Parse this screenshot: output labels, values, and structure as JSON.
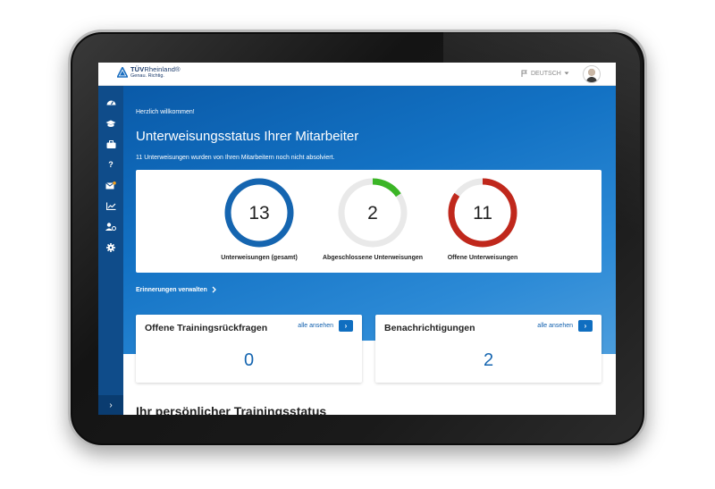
{
  "brand": {
    "name_bold": "TÜV",
    "name_rest": "Rheinland",
    "reg": "®",
    "tagline": "Genau. Richtig."
  },
  "header": {
    "language": "DEUTSCH"
  },
  "sidebar": {
    "items": [
      {
        "icon": "dashboard-icon"
      },
      {
        "icon": "graduation-cap-icon"
      },
      {
        "icon": "briefcase-icon"
      },
      {
        "icon": "help-icon",
        "glyph": "?"
      },
      {
        "icon": "mail-icon"
      },
      {
        "icon": "chart-icon"
      },
      {
        "icon": "user-settings-icon"
      },
      {
        "icon": "gear-icon"
      }
    ],
    "expand_glyph": "›"
  },
  "hero": {
    "greeting": "Herzlich willkommen!",
    "title": "Unterweisungsstatus Ihrer Mitarbeiter",
    "subtitle": "11 Unterweisungen wurden von Ihren Mitarbeitern noch nicht absolviert."
  },
  "stats": [
    {
      "value": "13",
      "label": "Unterweisungen (gesamt)",
      "progress": 1.0,
      "color": "#1565b0"
    },
    {
      "value": "2",
      "label": "Abgeschlossene Unterweisungen",
      "progress": 0.154,
      "color": "#3bb526"
    },
    {
      "value": "11",
      "label": "Offene Unterweisungen",
      "progress": 0.846,
      "color": "#c0281c"
    }
  ],
  "reminders": {
    "label": "Erinnerungen verwalten"
  },
  "cards": [
    {
      "title": "Offene Trainingsrückfragen",
      "link": "alle ansehen",
      "value": "0"
    },
    {
      "title": "Benachrichtigungen",
      "link": "alle ansehen",
      "value": "2"
    }
  ],
  "personal": {
    "title": "Ihr persönlicher Trainingsstatus"
  },
  "colors": {
    "primary": "#1565b0",
    "sidebar": "#0f4c8a",
    "ring_track": "#e9e9e9"
  }
}
